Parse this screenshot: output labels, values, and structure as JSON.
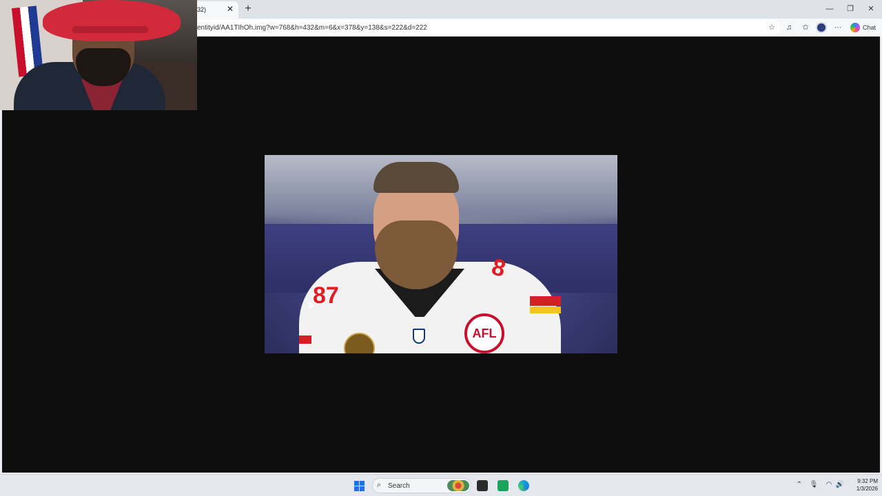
{
  "browser": {
    "tab_title": "32)",
    "tab_close": "✕",
    "new_tab": "+",
    "address_url": "entityid/AA1TIhOh.img?w=768&h=432&m=6&x=378&y=138&s=222&d=222",
    "chat_label": "Chat",
    "window_controls": {
      "minimize": "—",
      "restore": "❐",
      "close": "✕"
    },
    "toolbar_icons": [
      "star-icon",
      "read-aloud-icon",
      "favorites-icon",
      "profile-icon",
      "more-icon",
      "copilot-icon"
    ]
  },
  "content": {
    "image_subject": "football player photo",
    "jersey_numbers": {
      "left": "87",
      "right": "8"
    },
    "patch_text": "AFL"
  },
  "taskbar": {
    "search_placeholder": "Search",
    "time": "9:32 PM",
    "date": "1/3/2026",
    "apps": [
      "start-icon",
      "search-icon",
      "file-explorer-icon",
      "app-icon",
      "edge-icon"
    ]
  },
  "colors": {
    "viewport_bg": "#0e0e0e",
    "chrome_bg": "#dfe3e8",
    "accent_red": "#d32027",
    "accent_gold": "#f4c61c",
    "windows_blue": "#1a73e8"
  }
}
